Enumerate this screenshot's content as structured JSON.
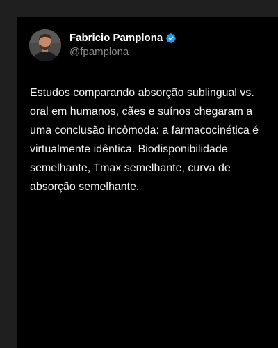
{
  "author": {
    "display_name": "Fabricio Pamplona",
    "handle": "@fpamplona",
    "verified": true
  },
  "post": {
    "text": "Estudos comparando absorção sublingual vs.\noral em humanos, cães e suínos chegaram a\numa conclusão incômoda: a farmacocinética é\nvirtualmente idêntica. Biodisponibilidade\nsemelhante, Tmax semelhante, curva de\nabsorção semelhante."
  },
  "colors": {
    "background": "#1f1f1f",
    "card": "#000000",
    "text": "#f2f2f2",
    "handle": "#8b8b8b",
    "verified": "#1d9bf0",
    "divider": "#3a3a3a"
  },
  "icons": {
    "verified": "verified-badge-icon",
    "avatar": "profile-photo"
  }
}
